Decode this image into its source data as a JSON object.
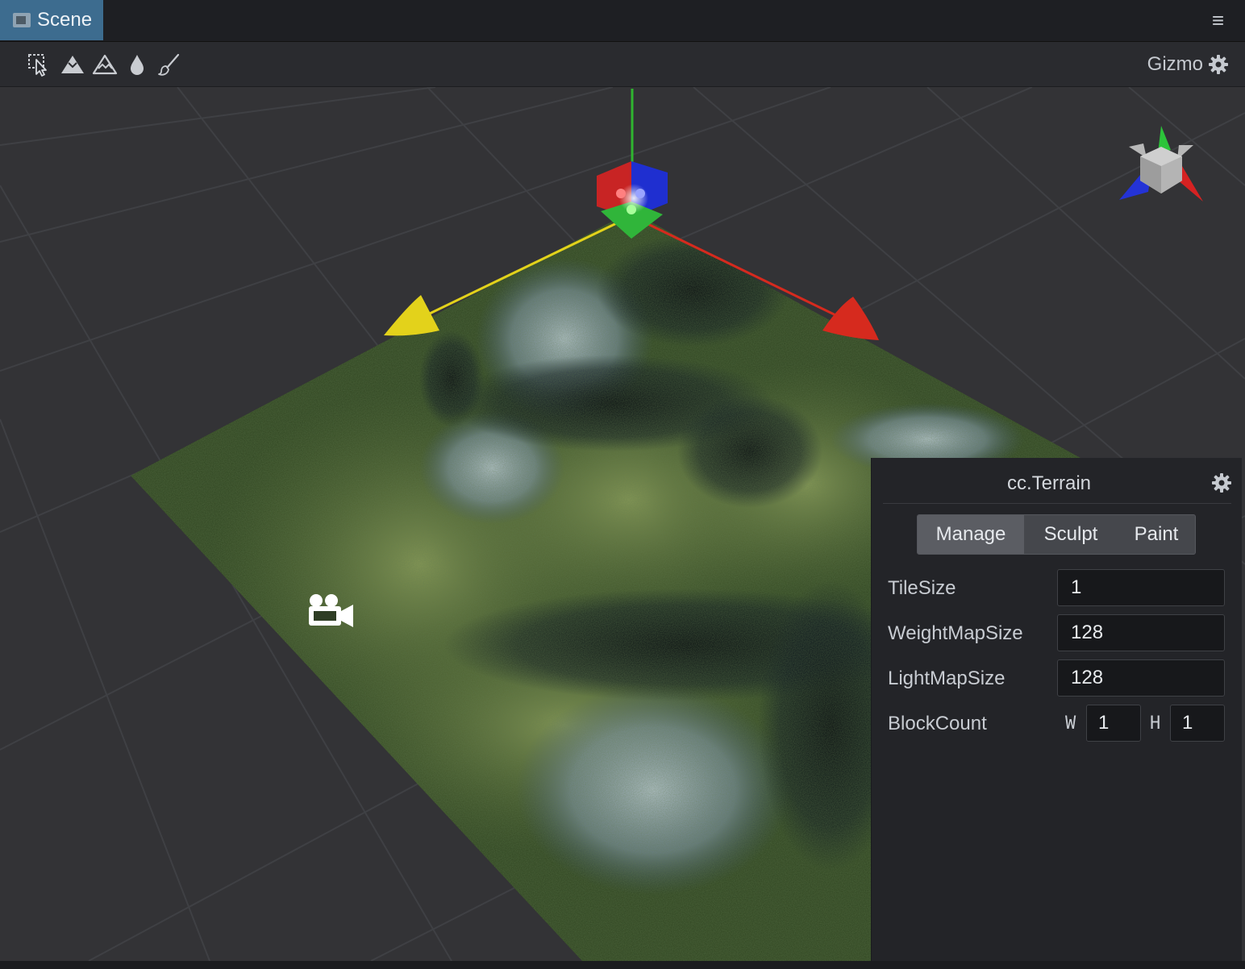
{
  "tab": {
    "title": "Scene"
  },
  "toolbar": {
    "tools": [
      "select-icon",
      "raise-terrain-icon",
      "smooth-terrain-icon",
      "water-drop-icon",
      "paint-brush-icon"
    ],
    "gizmo_label": "Gizmo"
  },
  "panel": {
    "title": "cc.Terrain",
    "tabs": [
      {
        "label": "Manage",
        "active": true
      },
      {
        "label": "Sculpt",
        "active": false
      },
      {
        "label": "Paint",
        "active": false
      }
    ],
    "props": {
      "tile_size": {
        "label": "TileSize",
        "value": "1"
      },
      "weight_map_size": {
        "label": "WeightMapSize",
        "value": "128"
      },
      "light_map_size": {
        "label": "LightMapSize",
        "value": "128"
      },
      "block_count": {
        "label": "BlockCount",
        "w_label": "W",
        "w_value": "1",
        "h_label": "H",
        "h_value": "1"
      }
    }
  },
  "colors": {
    "tab_active": "#3d6c8f",
    "axis_x": "#d62a1e",
    "axis_y": "#2fb52f",
    "axis_z": "#2430d8",
    "axis_yellow": "#e3d21b"
  }
}
